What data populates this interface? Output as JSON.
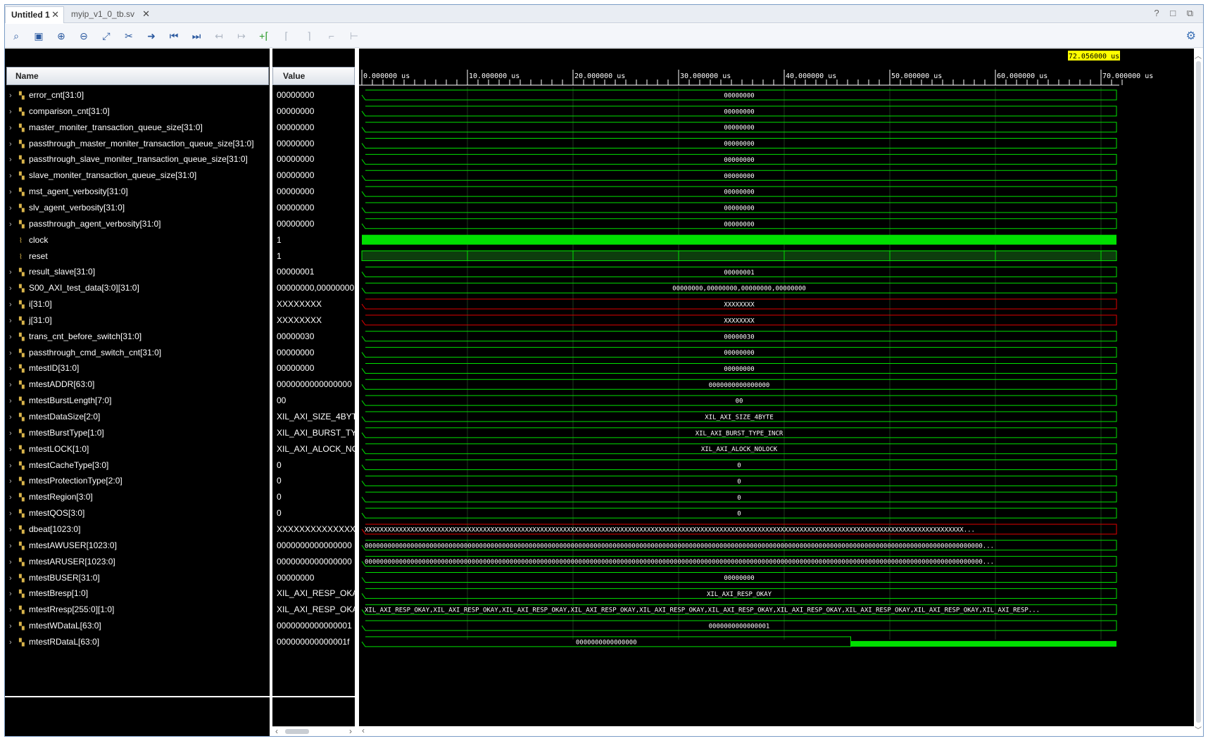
{
  "tabs": [
    {
      "label": "Untitled 1",
      "active": true
    },
    {
      "label": "myip_v1_0_tb.sv",
      "active": false
    }
  ],
  "window_controls": "? □ ⧉",
  "toolbar": {
    "icons": [
      "search-icon",
      "save-icon",
      "zoom-in-icon",
      "zoom-out-icon",
      "zoom-fit-icon",
      "cursor-icon",
      "go-to-cursor-icon",
      "go-to-time-zero-icon",
      "go-to-last-time-icon",
      "previous-transition-icon",
      "next-transition-icon",
      "add-marker-icon",
      "previous-marker-icon",
      "next-marker-icon",
      "swap-cursors-icon",
      "snap-icon"
    ],
    "settings_icon": "gear-icon"
  },
  "headers": {
    "name": "Name",
    "value": "Value"
  },
  "cursor_time": "72.056000 us",
  "timeline": {
    "ticks": [
      "0.000000 us",
      "10.000000 us",
      "20.000000 us",
      "30.000000 us",
      "40.000000 us",
      "50.000000 us",
      "60.000000 us",
      "70.000000 us"
    ],
    "max_us": 72.056
  },
  "colors": {
    "wave": "#00e000",
    "undefined": "#e00000",
    "cursor_bg": "#ffff00",
    "text": "#ffffff"
  },
  "signals": [
    {
      "name": "error_cnt[31:0]",
      "value": "00000000",
      "wave": "00000000",
      "kind": "bus"
    },
    {
      "name": "comparison_cnt[31:0]",
      "value": "00000000",
      "wave": "00000000",
      "kind": "bus"
    },
    {
      "name": "master_moniter_transaction_queue_size[31:0]",
      "value": "00000000",
      "wave": "00000000",
      "kind": "bus"
    },
    {
      "name": "passthrough_master_moniter_transaction_queue_size[31:0]",
      "value": "00000000",
      "wave": "00000000",
      "kind": "bus"
    },
    {
      "name": "passthrough_slave_moniter_transaction_queue_size[31:0]",
      "value": "00000000",
      "wave": "00000000",
      "kind": "bus"
    },
    {
      "name": "slave_moniter_transaction_queue_size[31:0]",
      "value": "00000000",
      "wave": "00000000",
      "kind": "bus"
    },
    {
      "name": "mst_agent_verbosity[31:0]",
      "value": "00000000",
      "wave": "00000000",
      "kind": "bus"
    },
    {
      "name": "slv_agent_verbosity[31:0]",
      "value": "00000000",
      "wave": "00000000",
      "kind": "bus"
    },
    {
      "name": "passthrough_agent_verbosity[31:0]",
      "value": "00000000",
      "wave": "00000000",
      "kind": "bus"
    },
    {
      "name": "clock",
      "value": "1",
      "wave": "",
      "kind": "clock"
    },
    {
      "name": "reset",
      "value": "1",
      "wave": "",
      "kind": "bit"
    },
    {
      "name": "result_slave[31:0]",
      "value": "00000001",
      "wave": "00000001",
      "kind": "bus"
    },
    {
      "name": "S00_AXI_test_data[3:0][31:0]",
      "value": "00000000,00000000",
      "wave": "00000000,00000000,00000000,00000000",
      "kind": "bus"
    },
    {
      "name": "i[31:0]",
      "value": "XXXXXXXX",
      "wave": "XXXXXXXX",
      "kind": "undef"
    },
    {
      "name": "j[31:0]",
      "value": "XXXXXXXX",
      "wave": "XXXXXXXX",
      "kind": "undef"
    },
    {
      "name": "trans_cnt_before_switch[31:0]",
      "value": "00000030",
      "wave": "00000030",
      "kind": "bus"
    },
    {
      "name": "passthrough_cmd_switch_cnt[31:0]",
      "value": "00000000",
      "wave": "00000000",
      "kind": "bus"
    },
    {
      "name": "mtestID[31:0]",
      "value": "00000000",
      "wave": "00000000",
      "kind": "bus"
    },
    {
      "name": "mtestADDR[63:0]",
      "value": "0000000000000000",
      "wave": "0000000000000000",
      "kind": "bus"
    },
    {
      "name": "mtestBurstLength[7:0]",
      "value": "00",
      "wave": "00",
      "kind": "bus"
    },
    {
      "name": "mtestDataSize[2:0]",
      "value": "XIL_AXI_SIZE_4BYTE",
      "wave": "XIL_AXI_SIZE_4BYTE",
      "kind": "bus"
    },
    {
      "name": "mtestBurstType[1:0]",
      "value": "XIL_AXI_BURST_TYPE_INCR",
      "wave": "XIL_AXI_BURST_TYPE_INCR",
      "kind": "bus"
    },
    {
      "name": "mtestLOCK[1:0]",
      "value": "XIL_AXI_ALOCK_NOLOCK",
      "wave": "XIL_AXI_ALOCK_NOLOCK",
      "kind": "bus"
    },
    {
      "name": "mtestCacheType[3:0]",
      "value": "0",
      "wave": "0",
      "kind": "bus"
    },
    {
      "name": "mtestProtectionType[2:0]",
      "value": "0",
      "wave": "0",
      "kind": "bus"
    },
    {
      "name": "mtestRegion[3:0]",
      "value": "0",
      "wave": "0",
      "kind": "bus"
    },
    {
      "name": "mtestQOS[3:0]",
      "value": "0",
      "wave": "0",
      "kind": "bus"
    },
    {
      "name": "dbeat[1023:0]",
      "value": "XXXXXXXXXXXXXXXX",
      "wave": "XXXXXXXXXXXXXXXXXXXXXXXXXXXXXXXXXXXXXXXXXXXXXXXXXXXXXXXXXXXXXXXXXXXXXXXXXXXXXXXXXXXXXXXXXXXXXXXXXXXXXXXXXXXXXXXXXXXXXXXXXXXXXXXXXXXXXXXXXXXXXXXXXXXXXXXXXXXXX...",
      "kind": "undef-long"
    },
    {
      "name": "mtestAWUSER[1023:0]",
      "value": "0000000000000000",
      "wave": "000000000000000000000000000000000000000000000000000000000000000000000000000000000000000000000000000000000000000000000000000000000000000000000000000000000000000000...",
      "kind": "bus-long"
    },
    {
      "name": "mtestARUSER[1023:0]",
      "value": "0000000000000000",
      "wave": "000000000000000000000000000000000000000000000000000000000000000000000000000000000000000000000000000000000000000000000000000000000000000000000000000000000000000000...",
      "kind": "bus-long"
    },
    {
      "name": "mtestBUSER[31:0]",
      "value": "00000000",
      "wave": "00000000",
      "kind": "bus"
    },
    {
      "name": "mtestBresp[1:0]",
      "value": "XIL_AXI_RESP_OKAY",
      "wave": "XIL_AXI_RESP_OKAY",
      "kind": "bus"
    },
    {
      "name": "mtestRresp[255:0][1:0]",
      "value": "XIL_AXI_RESP_OKAY",
      "wave": "XIL_AXI_RESP_OKAY,XIL_AXI_RESP_OKAY,XIL_AXI_RESP_OKAY,XIL_AXI_RESP_OKAY,XIL_AXI_RESP_OKAY,XIL_AXI_RESP_OKAY,XIL_AXI_RESP_OKAY,XIL_AXI_RESP_OKAY,XIL_AXI_RESP_OKAY,XIL_AXI_RESP...",
      "kind": "bus-long"
    },
    {
      "name": "mtestWDataL[63:0]",
      "value": "0000000000000001",
      "wave": "0000000000000001",
      "kind": "bus"
    },
    {
      "name": "mtestRDataL[63:0]",
      "value": "000000000000001f",
      "wave": "0000000000000000",
      "kind": "partial"
    }
  ]
}
